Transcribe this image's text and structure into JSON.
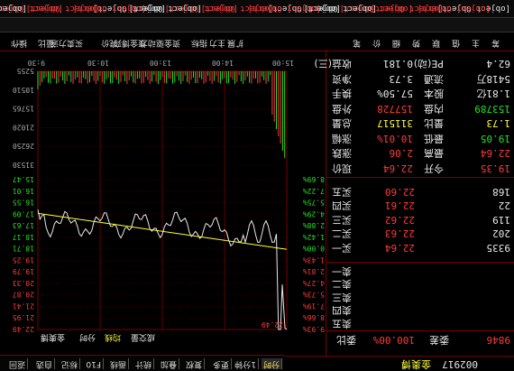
{
  "stock": {
    "code": "002917",
    "name": "金奥博"
  },
  "weibi": {
    "label": "委比",
    "value": "100.00%",
    "diff_label": "委差",
    "diff": "9846"
  },
  "asks": [
    {
      "label": "卖五",
      "price": "",
      "vol": ""
    },
    {
      "label": "卖四",
      "price": "",
      "vol": ""
    },
    {
      "label": "卖三",
      "price": "",
      "vol": ""
    },
    {
      "label": "卖二",
      "price": "",
      "vol": ""
    },
    {
      "label": "卖一",
      "price": "",
      "vol": ""
    }
  ],
  "bids": [
    {
      "label": "买一",
      "price": "22.64",
      "vol": "9335"
    },
    {
      "label": "买二",
      "price": "22.63",
      "vol": "202"
    },
    {
      "label": "买三",
      "price": "22.62",
      "vol": "119"
    },
    {
      "label": "买四",
      "price": "22.61",
      "vol": "22"
    },
    {
      "label": "买五",
      "price": "22.60",
      "vol": "168"
    }
  ],
  "quote": [
    {
      "l1": "现价",
      "v1": "22.64",
      "l2": "今开",
      "v2": "19.35"
    },
    {
      "l1": "涨跌",
      "v1": "2.06",
      "l2": "最高",
      "v2": "22.64"
    },
    {
      "l1": "涨幅",
      "v1": "10.01%",
      "l2": "最低",
      "v2": "19.05"
    },
    {
      "l1": "总量",
      "v1": "311517",
      "l2": "量比",
      "v2": "1.73"
    },
    {
      "l1": "外盘",
      "v1": "157728",
      "l2": "内盘",
      "v2": "153789"
    },
    {
      "l1": "换手",
      "v1": "57.50%",
      "l2": "股本",
      "v2": "1.81亿"
    },
    {
      "l1": "净资",
      "v1": "3.73",
      "l2": "流通",
      "v2": "5418万"
    },
    {
      "l1": "收益(三)",
      "v1": "0.181",
      "l2": "PE(动)",
      "v2": "62.4"
    }
  ],
  "toolbar": {
    "items": [
      "分时",
      "1分钟",
      "更多",
      "复权",
      "叠加",
      "统计",
      "画线",
      "F10",
      "标记",
      "自选",
      "返回"
    ]
  },
  "chart": {
    "header": [
      "金奥博",
      "分时",
      "均线",
      "成交量"
    ],
    "price_label_top": "22.49",
    "right_ticks": [
      "22.49",
      "21.95",
      "21.41",
      "20.87",
      "20.33",
      "19.79",
      "19.25",
      "18.71",
      "18.17",
      "17.63",
      "17.09",
      "16.55",
      "16.01",
      "15.47"
    ],
    "pct_ticks": [
      "9.93%",
      "8.66%",
      "7.19%",
      "5.73%",
      "4.27%",
      "2.81%",
      "1.43%",
      "0.00%",
      "1.42%",
      "2.88%",
      "4.29%",
      "5.75%",
      "7.22%",
      "8.69%"
    ],
    "left_ticks": [
      "22.64",
      "22.11",
      "21.58",
      "21.05",
      "20.51",
      "19.98",
      "19.45",
      "18.92",
      "18.39",
      "17.86",
      "17.33",
      "16.79",
      "16.26",
      "15.73"
    ],
    "vol_ticks": [
      "31530",
      "26250",
      "21020",
      "15765",
      "10510",
      "5255"
    ],
    "time_labels": [
      "9:30",
      "10:30",
      "13:00",
      "14:00",
      "15:00"
    ],
    "time_extra": "09:30"
  },
  "bottom_tabs": {
    "items": [
      "笔",
      "价",
      "细",
      "势",
      "联",
      "值",
      "主",
      "筹"
    ],
    "right_items": [
      "操作",
      "量比",
      "买卖力道",
      "竞价",
      "资金博弈",
      "资金驱动力",
      "指标",
      "主力",
      "扩展"
    ]
  },
  "status": {
    "items": [
      {
        "text": "上证",
        "color": "#e8e8e8"
      },
      {
        "text": "3006.45",
        "color": "#ff3b3b"
      },
      {
        "text": "7.17",
        "color": "#ff3b3b"
      },
      {
        "text": "0.24%",
        "color": "#ff3b3b"
      },
      {
        "text": "2184亿",
        "color": "#e8e8e8"
      },
      {
        "text": "深证",
        "color": "#e8e8e8"
      },
      {
        "text": "9881.25",
        "color": "#ff3b3b"
      },
      {
        "text": "20.29",
        "color": "#ff3b3b"
      },
      {
        "text": "0.21%",
        "color": "#ff3b3b"
      },
      {
        "text": "3285亿",
        "color": "#e8e8e8"
      },
      {
        "text": "中小",
        "color": "#e8e8e8"
      },
      {
        "text": "6253.91",
        "color": "#ff3b3b"
      },
      {
        "text": "27.66",
        "color": "#ff3b3b"
      },
      {
        "text": "0.44%",
        "color": "#ff3b3b"
      },
      {
        "text": "1408亿",
        "color": "#e8e8e8"
      }
    ]
  },
  "colors": {
    "up": "#ff3b3b",
    "down": "#25e025",
    "price_line": "#e8e8e8",
    "avg_line": "#ffff3b",
    "grid": "#7a0000"
  }
}
